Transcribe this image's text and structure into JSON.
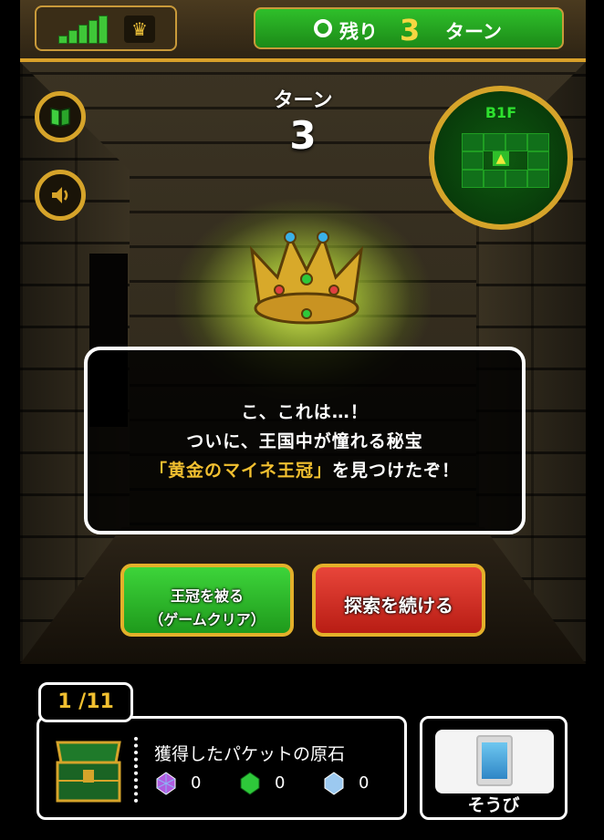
{
  "topbar": {
    "signal_bars": 5,
    "crown_icon": "crown-icon",
    "turns_label": "残り",
    "turns_remaining": "3",
    "turns_suffix": "ターン"
  },
  "turn": {
    "title": "ターン",
    "number": "3"
  },
  "side_buttons": [
    {
      "icon": "book-icon"
    },
    {
      "icon": "speaker-icon"
    }
  ],
  "minimap": {
    "floor": "B1F"
  },
  "dialog": {
    "line1": "こ、これは…！",
    "line2": "ついに、王国中が憧れる秘宝",
    "line3_highlight": "「黄金のマイネ王冠」",
    "line3_rest": "を見つけたぞ！"
  },
  "actions": {
    "wear_crown_line1": "王冠を被る",
    "wear_crown_line2": "（ゲームクリア）",
    "continue_explore": "探索を続ける"
  },
  "bottom": {
    "chest_count": "1 /11",
    "packet_title": "獲得したパケットの原石",
    "stones": [
      {
        "icon": "purple-gem-icon",
        "value": "0",
        "color": "#b05ce0"
      },
      {
        "icon": "green-gem-icon",
        "value": "0",
        "color": "#2ec83a"
      },
      {
        "icon": "blue-gem-icon",
        "value": "0",
        "color": "#9cc9f0"
      }
    ],
    "equip_label": "そうび"
  },
  "colors": {
    "gold": "#d9a12a",
    "accent_green": "#2fbf2a",
    "accent_red": "#d8322a",
    "highlight_text": "#f2c030"
  }
}
